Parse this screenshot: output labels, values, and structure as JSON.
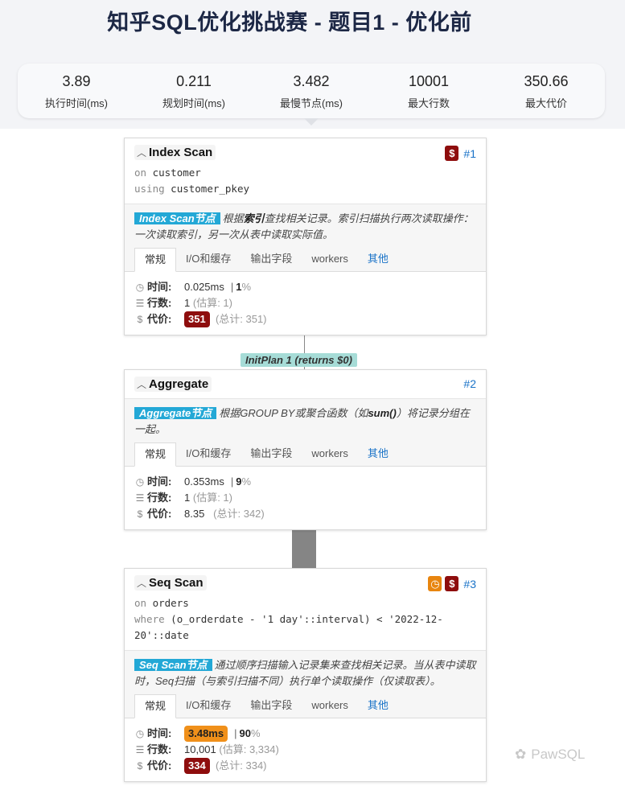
{
  "page_title": "知乎SQL优化挑战赛 - 题目1 - 优化前",
  "summary": [
    {
      "value": "3.89",
      "label": "执行时间(ms)"
    },
    {
      "value": "0.211",
      "label": "规划时间(ms)"
    },
    {
      "value": "3.482",
      "label": "最慢节点(ms)"
    },
    {
      "value": "10001",
      "label": "最大行数"
    },
    {
      "value": "350.66",
      "label": "最大代价"
    }
  ],
  "tabs": {
    "general": "常规",
    "io": "I/O和缓存",
    "output": "输出字段",
    "workers": "workers",
    "other": "其他"
  },
  "labels": {
    "time": "时间:",
    "rows": "行数:",
    "cost": "代价:"
  },
  "badge_glyphs": {
    "cost": "$",
    "time": "◷"
  },
  "initplan": "InitPlan 1 (returns $0)",
  "nodes": [
    {
      "name": "Index Scan",
      "number": "#1",
      "line1_kw": "on",
      "line1_val": "customer",
      "line2_kw": "using",
      "line2_val": "customer_pkey",
      "desc_tag": "Index Scan节点",
      "desc_pre": "根据",
      "desc_bold": "索引",
      "desc_post": "查找相关记录。索引扫描执行两次读取操作：一次读取索引，另一次从表中读取实际值。",
      "time": "0.025ms",
      "time_pct": "1",
      "pct_sign": "%",
      "rows": "1",
      "rows_est": "(估算: 1)",
      "cost": "351",
      "cost_total": "(总计: 351)"
    },
    {
      "name": "Aggregate",
      "number": "#2",
      "desc_tag": "Aggregate节点",
      "desc_pre": "根据GROUP BY或聚合函数（如",
      "desc_bold": "sum()",
      "desc_post": "）将记录分组在一起。",
      "time": "0.353ms",
      "time_pct": "9",
      "pct_sign": "%",
      "rows": "1",
      "rows_est": "(估算: 1)",
      "cost": "8.35",
      "cost_total": "(总计: 342)"
    },
    {
      "name": "Seq Scan",
      "number": "#3",
      "line1_kw": "on",
      "line1_val": "orders",
      "line2_kw": "where",
      "line2_val": "(o_orderdate - '1 day'::interval) < '2022-12-20'::date",
      "desc_tag": "Seq Scan节点",
      "desc_text": "通过顺序扫描输入记录集来查找相关记录。当从表中读取时，Seq扫描（与索引扫描不同）执行单个读取操作（仅读取表）。",
      "time": "3.48ms",
      "time_pct": "90",
      "pct_sign": "%",
      "rows": "10,001",
      "rows_est": "(估算: 3,334)",
      "cost": "334",
      "cost_total": "(总计: 334)"
    }
  ],
  "watermark": "PawSQL"
}
